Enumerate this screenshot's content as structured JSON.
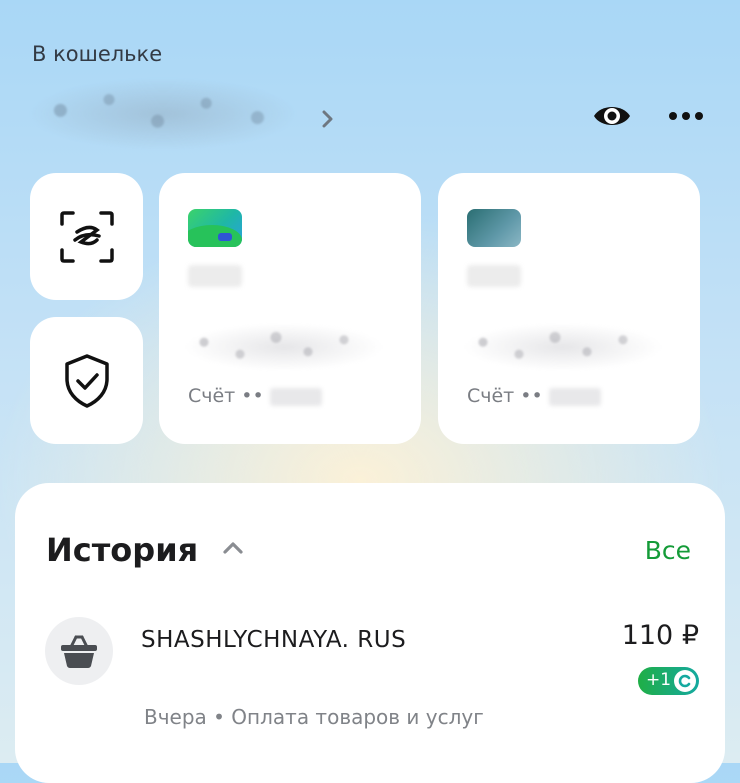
{
  "wallet": {
    "label": "В кошельке"
  },
  "cards": [
    {
      "account_label": "Счёт ••"
    },
    {
      "account_label": "Счёт ••"
    }
  ],
  "history": {
    "title": "История",
    "all_label": "Все",
    "transactions": [
      {
        "name": "SHASHLYCHNAYA. RUS",
        "amount": "110 ₽",
        "bonus": "+1",
        "subtitle": "Вчера • Оплата товаров и услуг",
        "icon": "shopping-basket-icon"
      }
    ]
  },
  "colors": {
    "accent_green": "#149b38",
    "bonus_gradient_start": "#1fae46",
    "bonus_gradient_end": "#15a9a0"
  }
}
